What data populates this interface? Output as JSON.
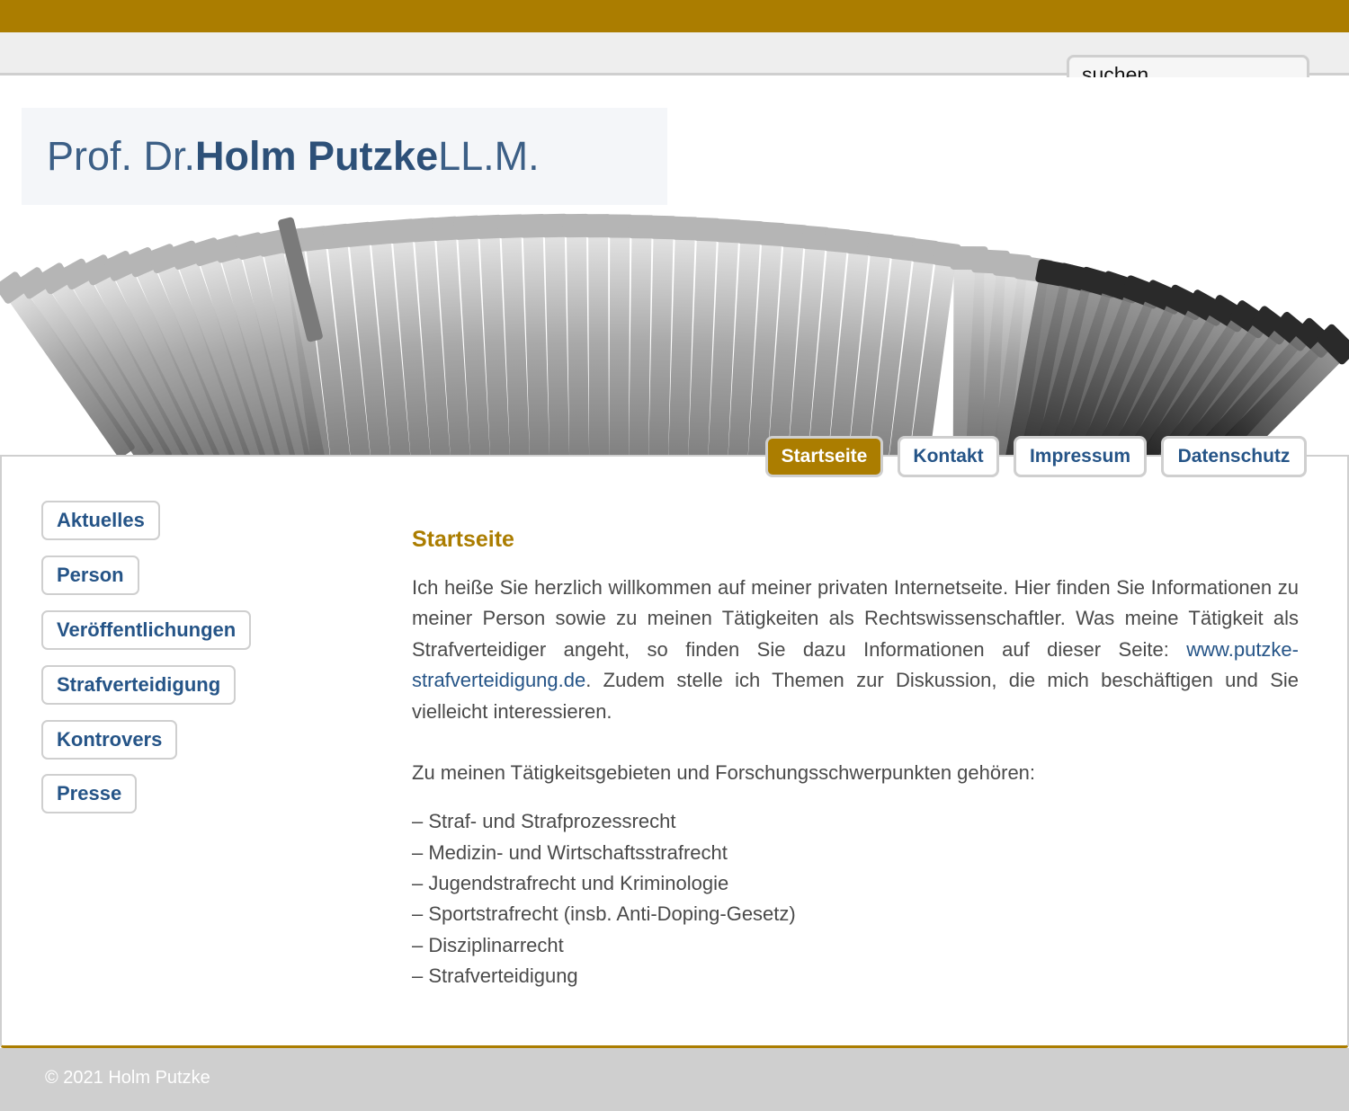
{
  "search": {
    "placeholder": "suchen..."
  },
  "logo": {
    "prefix": "Prof. Dr. ",
    "name": "Holm Putzke",
    "suffix": " LL.M."
  },
  "top_nav": [
    {
      "label": "Startseite",
      "active": true
    },
    {
      "label": "Kontakt",
      "active": false
    },
    {
      "label": "Impressum",
      "active": false
    },
    {
      "label": "Datenschutz",
      "active": false
    }
  ],
  "sidebar": [
    {
      "label": "Aktuelles"
    },
    {
      "label": "Person"
    },
    {
      "label": "Veröffentlichungen"
    },
    {
      "label": "Strafverteidigung"
    },
    {
      "label": "Kontrovers"
    },
    {
      "label": "Presse"
    }
  ],
  "main": {
    "title": "Startseite",
    "intro_before_link": "Ich heiße Sie herzlich willkommen auf meiner privaten Internetseite. Hier finden Sie Informationen zu meiner Person sowie zu meinen Tätigkeiten als Rechtswissenschaftler. Was meine Tätigkeit als Strafverteidiger angeht, so finden Sie dazu Informationen auf dieser Seite: ",
    "intro_link": "www.putzke-strafverteidigung.de",
    "intro_after_link": ". Zudem stelle ich Themen zur Diskussion, die mich beschäftigen und Sie vielleicht interessieren.",
    "areas_heading": "Zu meinen Tätigkeitsgebieten und Forschungsschwerpunkten gehören:",
    "areas": [
      "– Straf- und Strafprozessrecht",
      "– Medizin- und Wirtschaftsstrafrecht",
      "– Jugendstrafrecht und Kriminologie",
      "– Sportstrafrecht (insb. Anti-Doping-Gesetz)",
      "– Disziplinarrecht",
      "– Strafverteidigung"
    ]
  },
  "footer": {
    "copyright": "© 2021 Holm Putzke"
  },
  "colors": {
    "accent": "#ab7d00",
    "link": "#255487",
    "border": "#cfcfcf"
  }
}
